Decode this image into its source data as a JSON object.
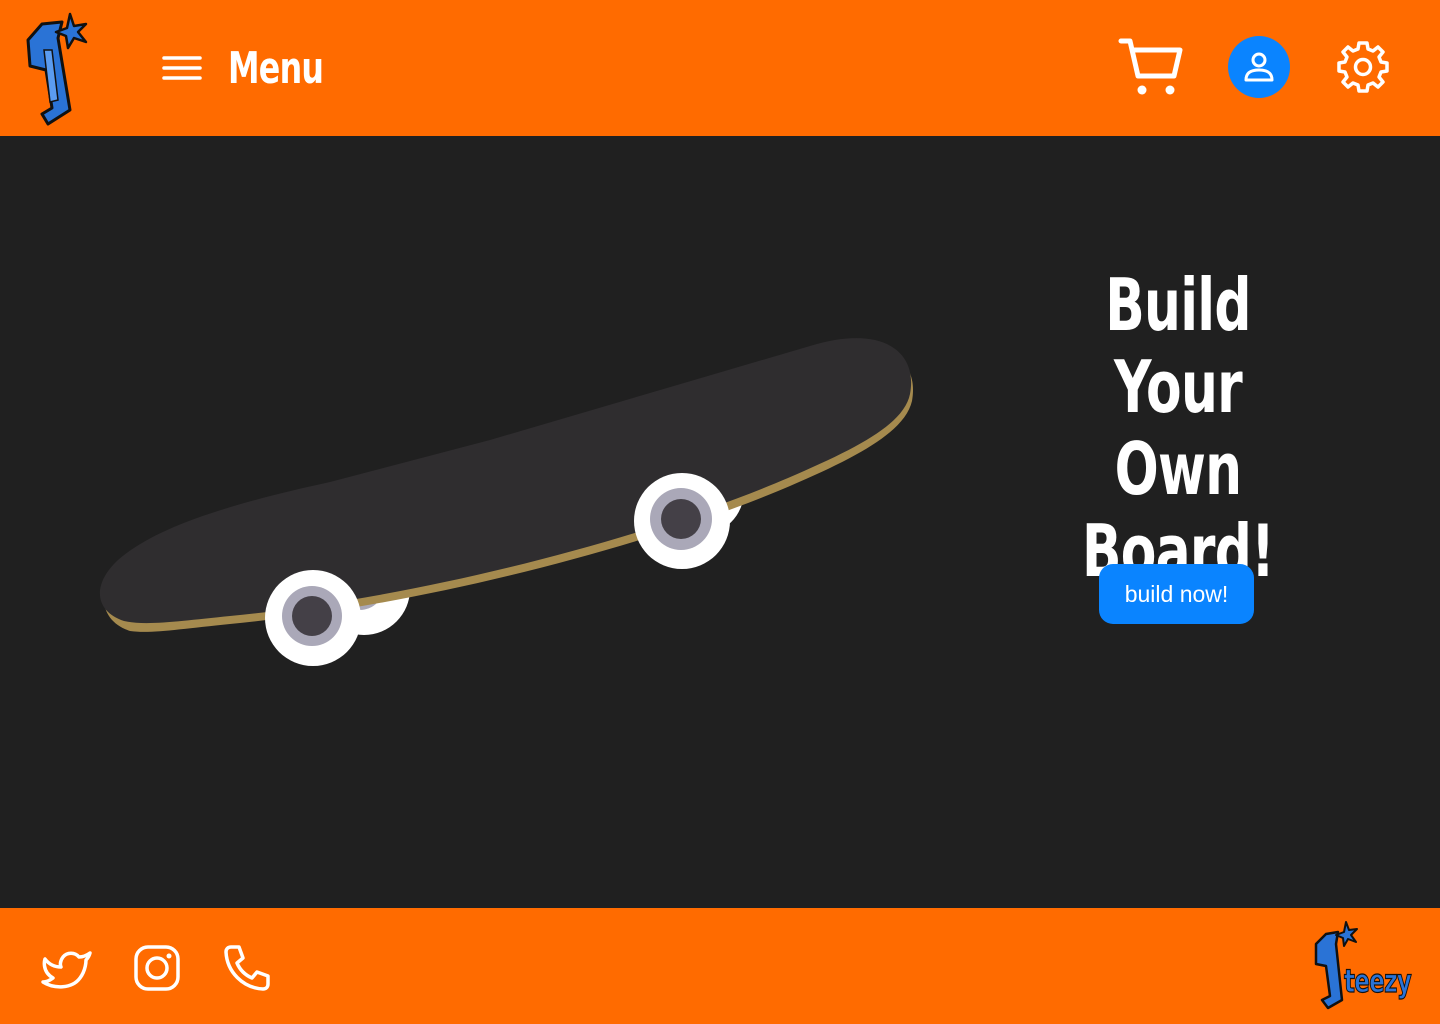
{
  "header": {
    "menu_label": "Menu",
    "icons": {
      "logo": "steezy-s-star-logo",
      "menu": "hamburger-icon",
      "cart": "cart-icon",
      "account": "user-icon",
      "settings": "gear-icon"
    }
  },
  "hero": {
    "headline_lines": [
      "Build Your",
      "Own",
      "Board!"
    ],
    "cta_label": "build now!",
    "image": "skateboard-illustration"
  },
  "footer": {
    "social": [
      "twitter-icon",
      "instagram-icon",
      "phone-icon"
    ],
    "brand_wordmark": "teezy"
  },
  "colors": {
    "brand_orange": "#ff6b00",
    "background": "#202020",
    "accent_blue": "#0a84ff",
    "board_deck": "#2f2d2f",
    "board_edge": "#a58a4e",
    "logo_blue": "#2a73d6"
  }
}
